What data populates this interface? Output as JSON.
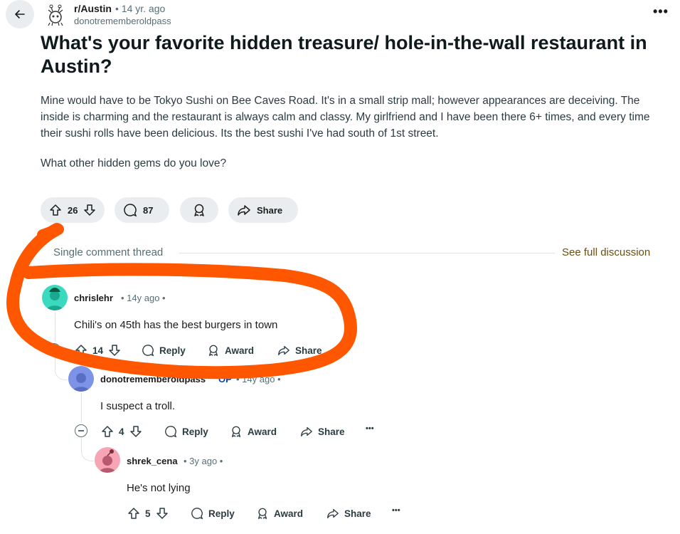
{
  "header": {
    "subreddit": "r/Austin",
    "post_age": "• 14 yr. ago",
    "author": "donotrememberoldpass",
    "more": "•••"
  },
  "post": {
    "title": "What's your favorite hidden treasure/ hole-in-the-wall restaurant in Austin?",
    "body_p1": "Mine would have to be Tokyo Sushi on Bee Caves Road. It's in a small strip mall; however appearances are deceiving. The inside is charming and the restaurant is always calm and classy. My girlfriend and I have been there 6+ times, and every time their sushi rolls have been delicious. Its the best sushi I've had south of 1st street.",
    "body_p2": "What other hidden gems do you love?",
    "votes": "26",
    "comments": "87",
    "share_label": "Share"
  },
  "thread": {
    "label": "Single comment thread",
    "see_full": "See full discussion"
  },
  "comments": [
    {
      "author": "chrislehr",
      "meta": "• 14y ago •",
      "text": "Chili's on 45th has the best burgers in town",
      "votes": "14",
      "reply": "Reply",
      "award": "Award",
      "share": "Share",
      "more": "•••"
    },
    {
      "author": "donotrememberoldpass",
      "op": "OP",
      "meta": "• 14y ago •",
      "text": "I suspect a troll.",
      "votes": "4",
      "reply": "Reply",
      "award": "Award",
      "share": "Share",
      "more": "•••"
    },
    {
      "author": "shrek_cena",
      "meta": "• 3y ago •",
      "text": "He's not lying",
      "votes": "5",
      "reply": "Reply",
      "award": "Award",
      "share": "Share",
      "more": "•••"
    }
  ],
  "colors": {
    "annotation": "#ff5700",
    "pill_bg": "#eaedef",
    "meta": "#576f76"
  }
}
